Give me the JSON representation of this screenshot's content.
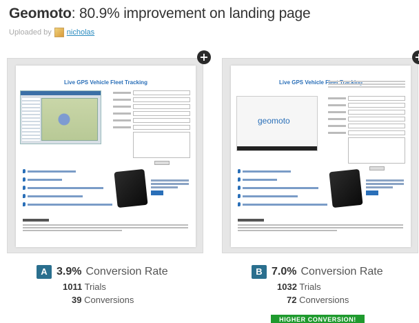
{
  "header": {
    "brand": "Geomoto",
    "subtitle": ": 80.9% improvement on landing page",
    "uploaded_by_label": "Uploaded by",
    "uploader_name": "nicholas"
  },
  "variant_a": {
    "letter": "A",
    "rate": "3.9%",
    "rate_label": "Conversion Rate",
    "trials_value": "1011",
    "trials_label": "Trials",
    "conversions_value": "39",
    "conversions_label": "Conversions",
    "screenshot_heading": "Live GPS Vehicle Fleet Tracking"
  },
  "variant_b": {
    "letter": "B",
    "rate": "7.0%",
    "rate_label": "Conversion Rate",
    "trials_value": "1032",
    "trials_label": "Trials",
    "conversions_value": "72",
    "conversions_label": "Conversions",
    "screenshot_heading": "Live GPS Vehicle Fleet Tracking",
    "video_logo": "geomoto",
    "winner_label": "HIGHER CONVERSION!"
  },
  "icons": {
    "expand": "plus-circle-icon",
    "map_pin": "map-pin-icon"
  },
  "colors": {
    "badge": "#2a6f8e",
    "winner": "#1f9a2e",
    "link": "#2a8bbf"
  }
}
